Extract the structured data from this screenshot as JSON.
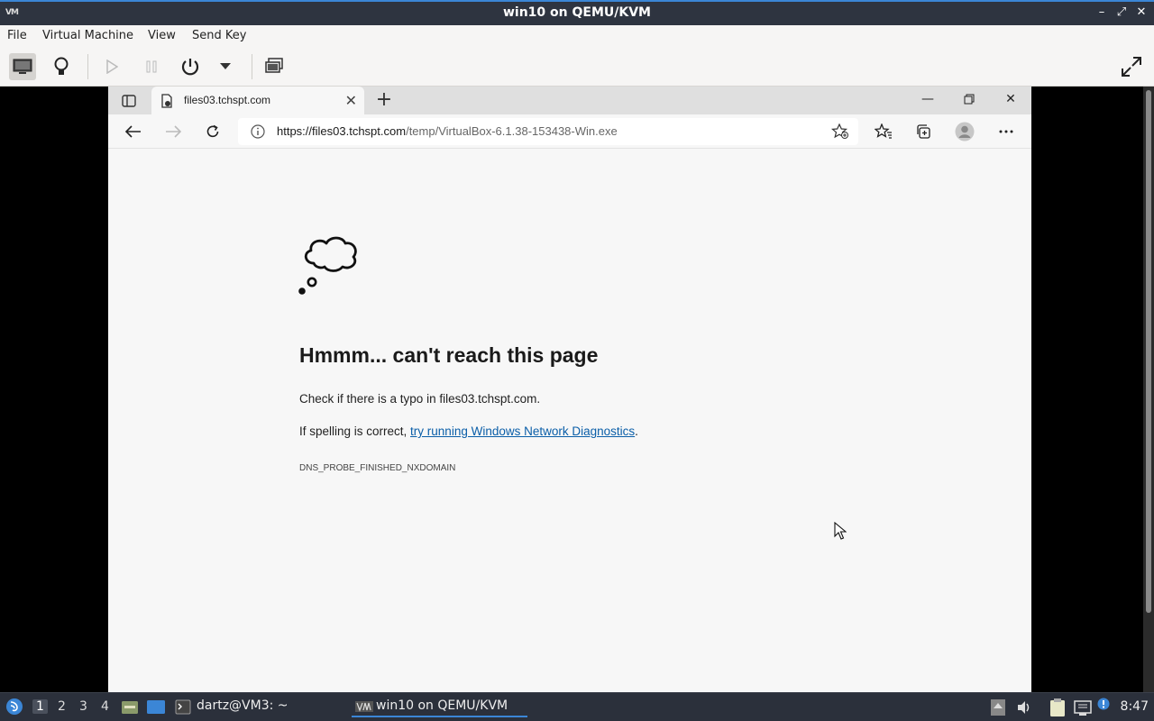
{
  "window": {
    "title": "win10 on QEMU/KVM",
    "app_icon_text": "VM"
  },
  "menubar": [
    "File",
    "Virtual Machine",
    "View",
    "Send Key"
  ],
  "browser": {
    "tab_title": "files03.tchspt.com",
    "url_host": "https://files03.tchspt.com",
    "url_path": "/temp/VirtualBox-6.1.38-153438-Win.exe"
  },
  "error": {
    "heading": "Hmmm... can't reach this page",
    "line1": "Check if there is a typo in files03.tchspt.com.",
    "line2_prefix": "If spelling is correct, ",
    "line2_link": "try running Windows Network Diagnostics",
    "line2_suffix": ".",
    "code": "DNS_PROBE_FINISHED_NXDOMAIN"
  },
  "taskbar": {
    "workspaces": [
      "1",
      "2",
      "3",
      "4"
    ],
    "terminal_task": "dartz@VM3: ~",
    "vm_task": "win10 on QEMU/KVM",
    "clock": "8:47"
  },
  "colors": {
    "accent": "#3b86d6",
    "link": "#0a5ea8",
    "taskbar": "#2b303b"
  }
}
